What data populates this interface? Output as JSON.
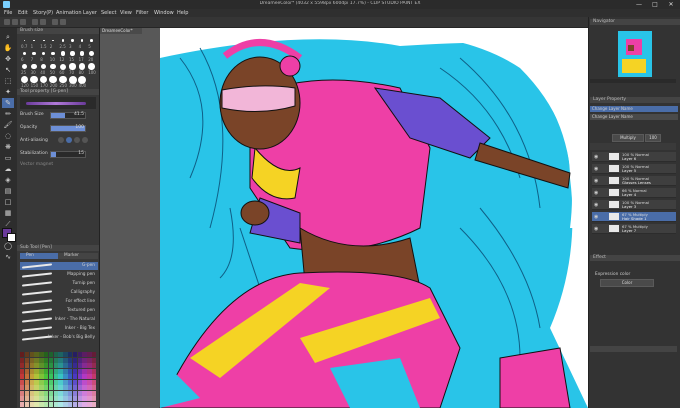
{
  "window": {
    "title": "DreameeColor* (4032 x 5598px 600dpi 17.7%) - CLIP STUDIO PAINT EX",
    "min": "—",
    "max": "□",
    "close": "✕"
  },
  "menu": [
    "File",
    "Edit",
    "Story(P)",
    "Animation",
    "Layer",
    "Select",
    "View",
    "Filter",
    "Window",
    "Help"
  ],
  "tab": {
    "label": "DreameeColor*"
  },
  "brush_size_panel": {
    "title": "Brush size"
  },
  "brush_sizes": [
    "0.7",
    "1",
    "1.5",
    "2",
    "2.5",
    "3",
    "4",
    "5",
    "6",
    "7",
    "8",
    "10",
    "12",
    "15",
    "17",
    "20",
    "25",
    "30",
    "40",
    "50",
    "60",
    "70",
    "80",
    "100",
    "120",
    "150",
    "170",
    "200",
    "250",
    "300",
    "400"
  ],
  "tool_property": {
    "title": "Tool property [G-pen]",
    "brush_name": "G-pen",
    "brush_size_label": "Brush Size",
    "brush_size_value": "41.5",
    "opacity_label": "Opacity",
    "opacity_value": "100",
    "antialias_label": "Anti-aliasing",
    "stabilization_label": "Stabilization",
    "stabilization_value": "15",
    "vector_label": "Vector magnet",
    "opacity_fraction": 1.0,
    "stabilization_fraction": 0.15
  },
  "subtool": {
    "title": "Sub Tool [Pen]",
    "tabs": [
      "Pen",
      "Marker"
    ],
    "items": [
      "G-pen",
      "Mapping pen",
      "Turnip pen",
      "Calligraphy",
      "For effect line",
      "Textured pen",
      "Inker - The Natural",
      "Inker - Big Tex",
      "Inker - Bob's Big Belly"
    ]
  },
  "navigator": {
    "title": "Navigator"
  },
  "layer_property": {
    "title": "Layer Property"
  },
  "layers_panel": {
    "header": "Change Layer Name",
    "blend": "Multiply",
    "opacity": "100",
    "layers": [
      {
        "pct": "100 % Normal",
        "name": "Layer 6"
      },
      {
        "pct": "100 % Normal",
        "name": "Layer 5"
      },
      {
        "pct": "100 % Normal",
        "name": "Glasses Lenses"
      },
      {
        "pct": "66 % Normal",
        "name": "Layer 4"
      },
      {
        "pct": "100 % Normal",
        "name": "Layer 3"
      },
      {
        "pct": "67 % Multiply",
        "name": "Hair Shade 1"
      },
      {
        "pct": "67 % Multiply",
        "name": "Layer 7"
      }
    ]
  },
  "effect": {
    "title": "Effect",
    "expression_label": "Expression color",
    "expression_value": "Color"
  },
  "colors": {
    "accent": "#4a6da8",
    "hair": "#29c4e8",
    "pink": "#ee3fa6",
    "yellow": "#f5d324",
    "purple": "#6a4fd0",
    "skin": "#7a4428"
  }
}
